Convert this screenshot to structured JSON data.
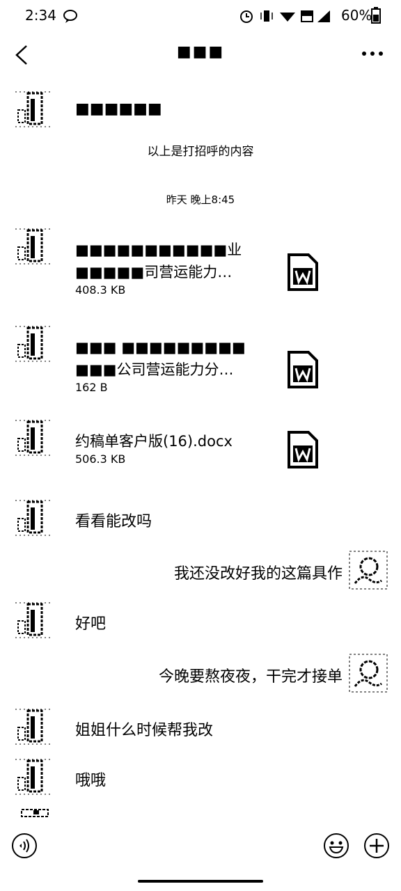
{
  "status_bar": {
    "time": "2:34",
    "battery": "60%",
    "icons": [
      "chat-bubble-icon",
      "alarm-icon",
      "vibrate-icon",
      "wifi-icon",
      "volte-icon",
      "signal-icon",
      "battery-icon"
    ]
  },
  "header": {
    "title": "■■■",
    "back_icon": "chevron-left-icon",
    "more_icon": "more-dots-icon"
  },
  "messages": [
    {
      "side": "left",
      "text": "■■■■■■"
    },
    {
      "type": "system",
      "text": "以上是打招呼的内容"
    },
    {
      "type": "time",
      "text": "昨天 晚上8:45"
    },
    {
      "side": "left",
      "type": "file",
      "line1": "■■■■■■■■■■■业",
      "line2": "■■■■■司营运能力…",
      "size": "408.3 KB",
      "icon": "word-doc-icon"
    },
    {
      "side": "left",
      "type": "file",
      "line1": "■■■ ■■■■■■■■■",
      "line2": "■■■公司营运能力分…",
      "size": "162 B",
      "icon": "word-doc-icon"
    },
    {
      "side": "left",
      "type": "file",
      "line1": "约稿单客户版(16).docx",
      "size": "506.3 KB",
      "icon": "word-doc-icon"
    },
    {
      "side": "left",
      "text": "看看能改吗"
    },
    {
      "side": "right",
      "text": "我还没改好我的这篇具作"
    },
    {
      "side": "left",
      "text": "好吧"
    },
    {
      "side": "right",
      "text": "今晚要熬夜夜，干完才接单"
    },
    {
      "side": "left",
      "text": "姐姐什么时候帮我改"
    },
    {
      "side": "left",
      "text": "哦哦"
    }
  ],
  "input_bar": {
    "voice_icon": "voice-icon",
    "emoji_icon": "emoji-icon",
    "plus_icon": "plus-icon"
  }
}
